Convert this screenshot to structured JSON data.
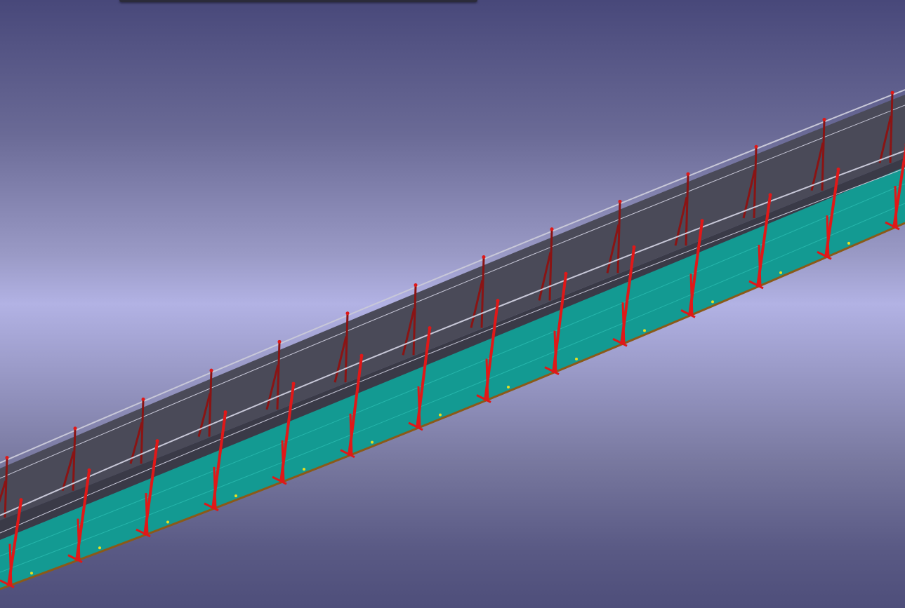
{
  "viewport": {
    "background_top": "#48487a",
    "background_horizon": "#b2b2e4",
    "background_bottom": "#4e4e7a"
  },
  "model": {
    "wall_color": "#4a4a58",
    "wall_shadow_color": "#3a3a47",
    "deck_color": "#139a92",
    "deck_edge_color": "#8a5a18",
    "post_color": "#e01818",
    "far_post_color": "#8a1414",
    "rail_color": "#c8c8d8",
    "bolt_color": "#e8e020"
  }
}
